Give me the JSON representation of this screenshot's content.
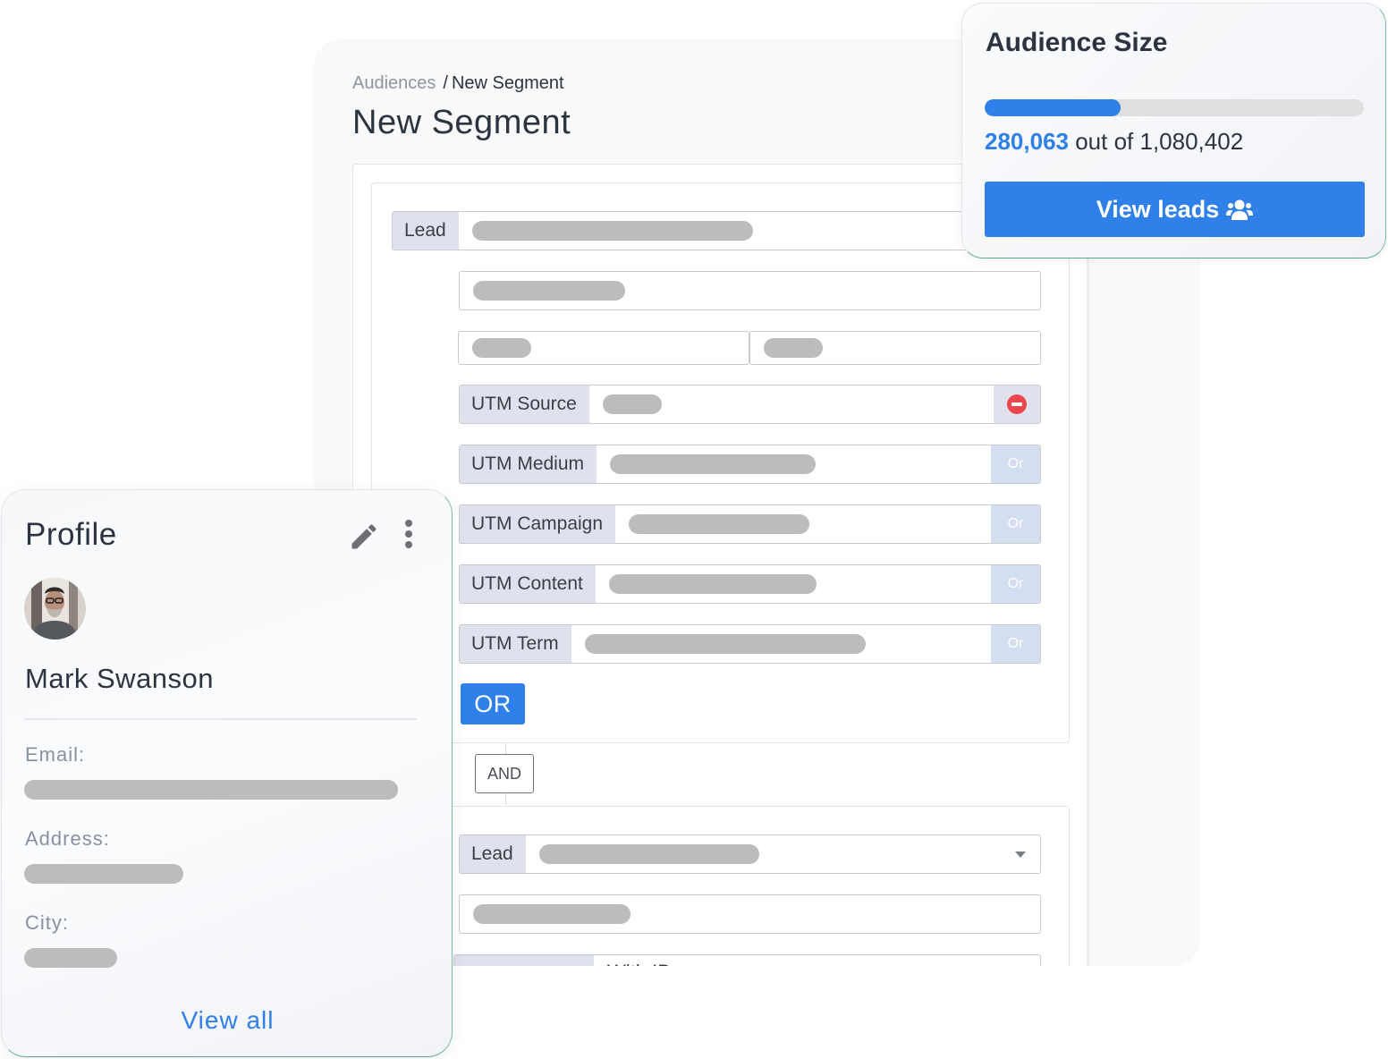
{
  "segment_editor": {
    "breadcrumb": {
      "root": "Audiences",
      "separator": "/",
      "current": "New Segment"
    },
    "title": "New Segment",
    "group_1": {
      "lead_field": {
        "prefix": "Lead"
      },
      "utm_filters": [
        {
          "label": "UTM Source",
          "action": "remove"
        },
        {
          "label": "UTM Medium",
          "action": "Or"
        },
        {
          "label": "UTM Campaign",
          "action": "Or"
        },
        {
          "label": "UTM Content",
          "action": "Or"
        },
        {
          "label": "UTM Term",
          "action": "Or"
        }
      ],
      "or_button": "OR"
    },
    "and_button": "AND",
    "group_2": {
      "lead_field": {
        "prefix": "Lead"
      },
      "partial_field_text": "With ID"
    }
  },
  "audience_size": {
    "title": "Audience Size",
    "count": "280,063",
    "count_value": 280063,
    "total_text": "out of 1,080,402",
    "total_value": 1080402,
    "progress_fraction": 0.259,
    "button_label": "View leads",
    "button_icon": "users-icon",
    "colors": {
      "accent": "#2f80e8",
      "track": "#dfdfdf"
    }
  },
  "profile": {
    "title": "Profile",
    "edit_icon": "pencil-icon",
    "menu_icon": "more-vertical-icon",
    "name": "Mark Swanson",
    "fields": [
      {
        "label": "Email:"
      },
      {
        "label": "Address:"
      },
      {
        "label": "City:"
      }
    ],
    "view_all": "View all"
  },
  "colors": {
    "primary": "#2f80e8",
    "danger": "#e8474c",
    "prefix_bg": "#dfe2ec",
    "or_bg": "#d3dff0",
    "skeleton": "#bcbcbc",
    "text_dark": "#2b3440",
    "card_accent_border": "#5aa88b"
  }
}
